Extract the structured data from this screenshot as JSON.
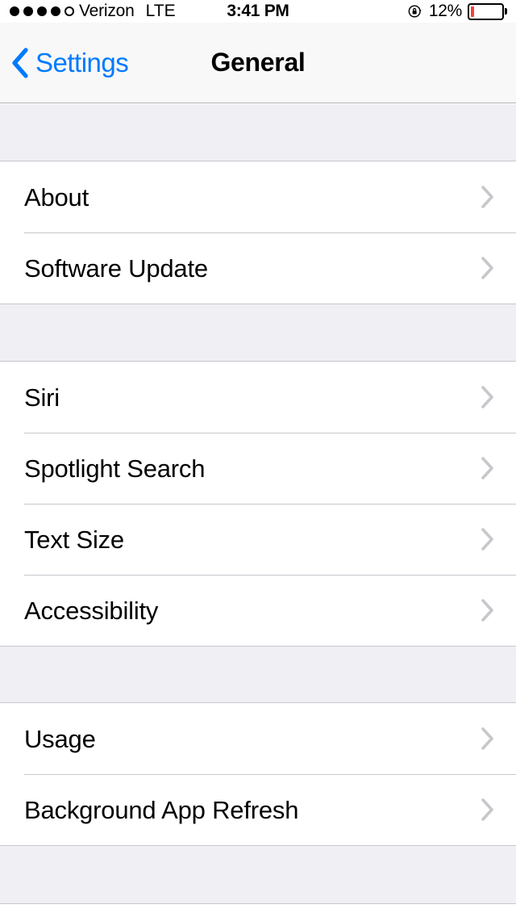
{
  "status_bar": {
    "signal_dots_filled": 4,
    "signal_dots_total": 5,
    "carrier": "Verizon",
    "network_type": "LTE",
    "time": "3:41 PM",
    "rotation_lock_icon": "rotation-lock-icon",
    "battery_percent": "12%",
    "battery_level": 12,
    "battery_color": "#fc3d39"
  },
  "nav_bar": {
    "back_icon": "chevron-left-icon",
    "back_label": "Settings",
    "title": "General",
    "tint_color": "#007aff",
    "background_color": "#f8f8f8"
  },
  "table": {
    "background_color": "#efeff4",
    "cell_background_color": "#ffffff",
    "separator_color": "#c8c7cc",
    "disclosure_icon": "chevron-right-icon",
    "disclosure_color": "#c7c7cc",
    "sections": [
      {
        "id": "section-device",
        "rows": [
          {
            "label": "About",
            "accessory": "disclosure"
          },
          {
            "label": "Software Update",
            "accessory": "disclosure"
          }
        ]
      },
      {
        "id": "section-assistive",
        "rows": [
          {
            "label": "Siri",
            "accessory": "disclosure"
          },
          {
            "label": "Spotlight Search",
            "accessory": "disclosure"
          },
          {
            "label": "Text Size",
            "accessory": "disclosure"
          },
          {
            "label": "Accessibility",
            "accessory": "disclosure"
          }
        ]
      },
      {
        "id": "section-usage",
        "rows": [
          {
            "label": "Usage",
            "accessory": "disclosure"
          },
          {
            "label": "Background App Refresh",
            "accessory": "disclosure"
          }
        ]
      }
    ]
  }
}
